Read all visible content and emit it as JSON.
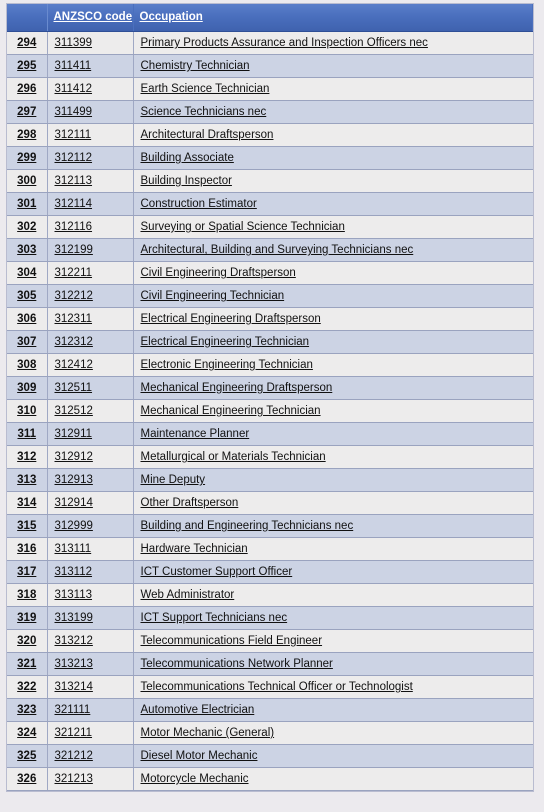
{
  "table": {
    "columns": {
      "index_header": "",
      "code_header": "ANZSCO code",
      "occupation_header": "Occupation"
    },
    "rows": [
      {
        "index": "294",
        "code": "311399",
        "occupation": "Primary Products Assurance and Inspection Officers nec"
      },
      {
        "index": "295",
        "code": "311411",
        "occupation": "Chemistry Technician"
      },
      {
        "index": "296",
        "code": "311412",
        "occupation": "Earth Science Technician"
      },
      {
        "index": "297",
        "code": "311499",
        "occupation": "Science Technicians nec"
      },
      {
        "index": "298",
        "code": "312111",
        "occupation": "Architectural Draftsperson"
      },
      {
        "index": "299",
        "code": "312112",
        "occupation": "Building Associate"
      },
      {
        "index": "300",
        "code": "312113",
        "occupation": "Building Inspector"
      },
      {
        "index": "301",
        "code": "312114",
        "occupation": "Construction Estimator"
      },
      {
        "index": "302",
        "code": "312116",
        "occupation": "Surveying or Spatial Science Technician"
      },
      {
        "index": "303",
        "code": "312199",
        "occupation": "Architectural, Building and Surveying Technicians nec"
      },
      {
        "index": "304",
        "code": "312211",
        "occupation": "Civil Engineering Draftsperson"
      },
      {
        "index": "305",
        "code": "312212",
        "occupation": "Civil Engineering Technician"
      },
      {
        "index": "306",
        "code": "312311",
        "occupation": "Electrical Engineering Draftsperson"
      },
      {
        "index": "307",
        "code": "312312",
        "occupation": "Electrical Engineering Technician"
      },
      {
        "index": "308",
        "code": "312412",
        "occupation": "Electronic Engineering Technician"
      },
      {
        "index": "309",
        "code": "312511",
        "occupation": "Mechanical Engineering Draftsperson"
      },
      {
        "index": "310",
        "code": "312512",
        "occupation": "Mechanical Engineering Technician"
      },
      {
        "index": "311",
        "code": "312911",
        "occupation": "Maintenance Planner"
      },
      {
        "index": "312",
        "code": "312912",
        "occupation": "Metallurgical or Materials Technician"
      },
      {
        "index": "313",
        "code": "312913",
        "occupation": "Mine Deputy"
      },
      {
        "index": "314",
        "code": "312914",
        "occupation": "Other Draftsperson"
      },
      {
        "index": "315",
        "code": "312999",
        "occupation": "Building and Engineering Technicians nec"
      },
      {
        "index": "316",
        "code": "313111",
        "occupation": "Hardware Technician"
      },
      {
        "index": "317",
        "code": "313112",
        "occupation": "ICT Customer Support Officer"
      },
      {
        "index": "318",
        "code": "313113",
        "occupation": "Web Administrator"
      },
      {
        "index": "319",
        "code": "313199",
        "occupation": "ICT Support Technicians nec"
      },
      {
        "index": "320",
        "code": "313212",
        "occupation": "Telecommunications Field Engineer"
      },
      {
        "index": "321",
        "code": "313213",
        "occupation": "Telecommunications Network Planner"
      },
      {
        "index": "322",
        "code": "313214",
        "occupation": "Telecommunications Technical Officer or Technologist"
      },
      {
        "index": "323",
        "code": "321111",
        "occupation": "Automotive Electrician"
      },
      {
        "index": "324",
        "code": "321211",
        "occupation": "Motor Mechanic (General)"
      },
      {
        "index": "325",
        "code": "321212",
        "occupation": "Diesel Motor Mechanic"
      },
      {
        "index": "326",
        "code": "321213",
        "occupation": "Motorcycle Mechanic"
      }
    ]
  },
  "colors": {
    "header_background": "#4a6fbe",
    "header_text": "#ffffff",
    "row_odd_background": "#edecec",
    "row_even_background": "#ccd3e4",
    "page_background": "#eceaee",
    "grid_line": "#9fa8c4"
  }
}
